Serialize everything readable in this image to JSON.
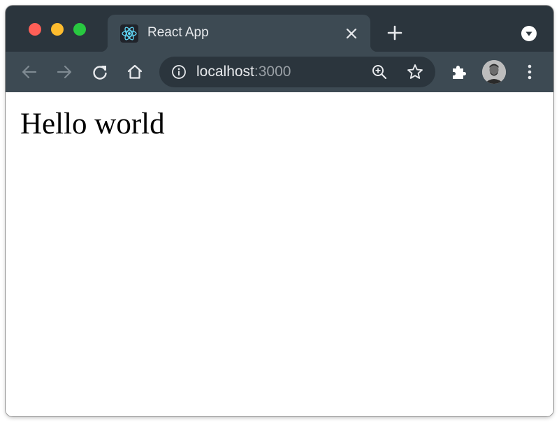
{
  "window": {
    "traffic_lights": {
      "close": "#ff5f57",
      "minimize": "#febc2e",
      "maximize": "#28c840"
    }
  },
  "tab": {
    "title": "React App",
    "favicon": "react-logo-icon",
    "close_icon": "close-icon"
  },
  "tabstrip": {
    "new_tab_icon": "plus-icon",
    "tab_search_icon": "chevron-down-circle-icon"
  },
  "toolbar": {
    "back_icon": "arrow-left-icon",
    "forward_icon": "arrow-right-icon",
    "reload_icon": "reload-icon",
    "home_icon": "home-icon",
    "extensions_icon": "puzzle-icon",
    "menu_icon": "vertical-dots-icon"
  },
  "omnibox": {
    "host": "localhost",
    "port": ":3000",
    "info_icon": "info-icon",
    "zoom_icon": "zoom-in-icon",
    "bookmark_icon": "star-icon"
  },
  "page": {
    "heading": "Hello world"
  },
  "colors": {
    "titlebar": "#2b353d",
    "toolbar": "#3d4a53",
    "omnibox": "#2b353d",
    "react_accent": "#61dafb"
  }
}
